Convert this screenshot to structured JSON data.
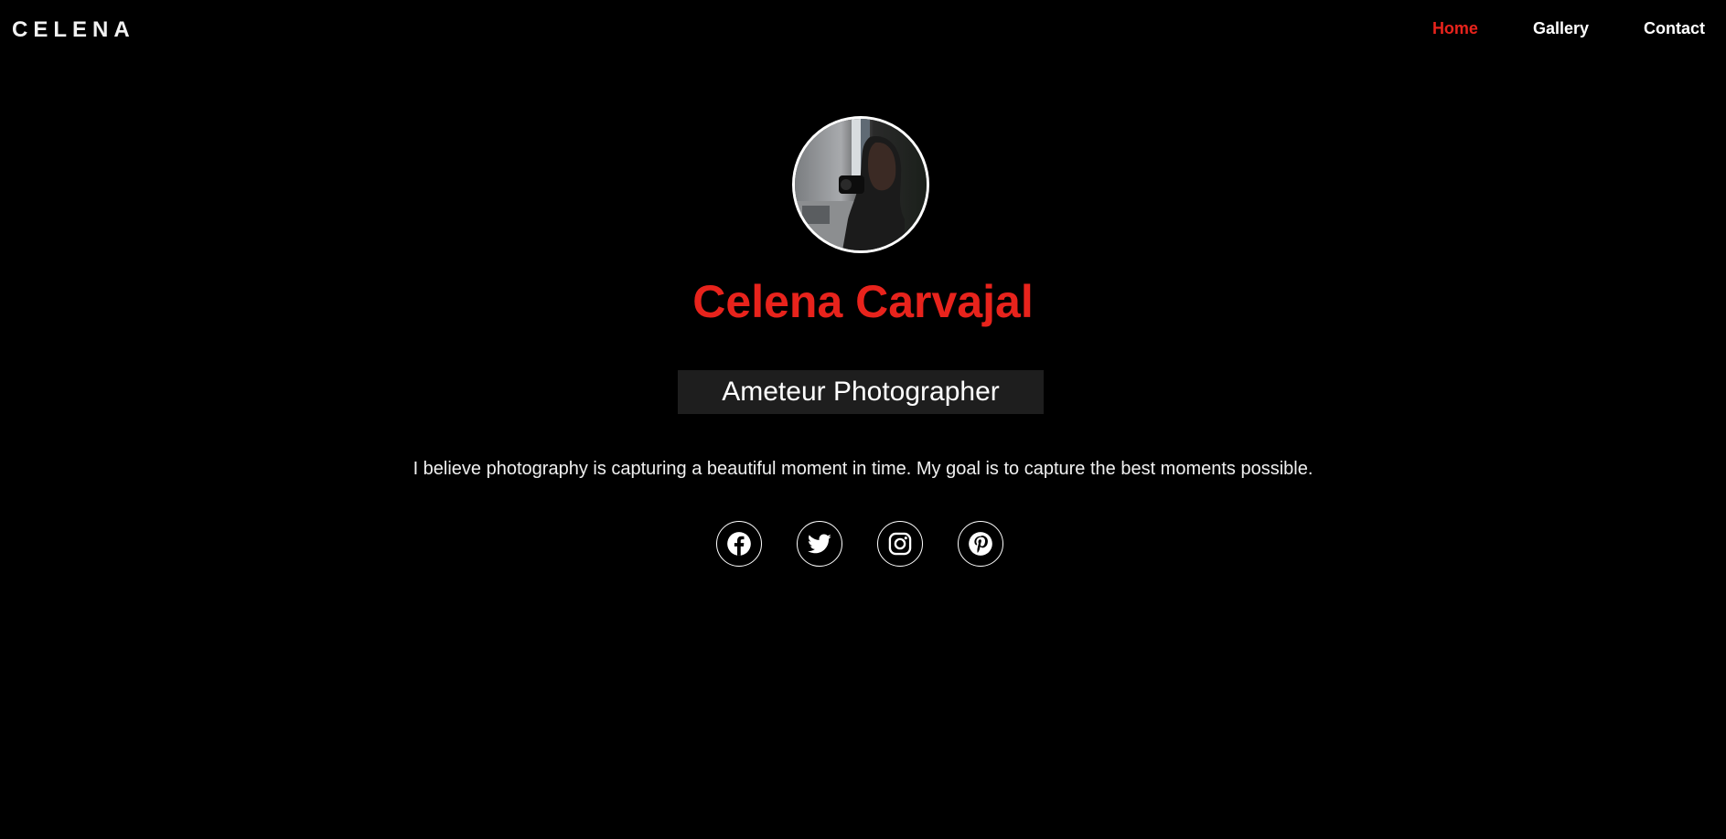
{
  "header": {
    "logo": "CELENA",
    "nav": [
      {
        "label": "Home",
        "active": true
      },
      {
        "label": "Gallery",
        "active": false
      },
      {
        "label": "Contact",
        "active": false
      }
    ]
  },
  "profile": {
    "name": "Celena Carvajal",
    "role": "Ameteur Photographer",
    "tagline": "I believe photography is capturing a beautiful moment in time. My goal is to capture the best moments possible."
  },
  "socials": [
    {
      "icon": "facebook-icon"
    },
    {
      "icon": "twitter-icon"
    },
    {
      "icon": "instagram-icon"
    },
    {
      "icon": "pinterest-icon"
    }
  ],
  "colors": {
    "background": "#000000",
    "accent": "#e8231c",
    "role_box": "#1e1e1e",
    "text": "#ffffff"
  }
}
